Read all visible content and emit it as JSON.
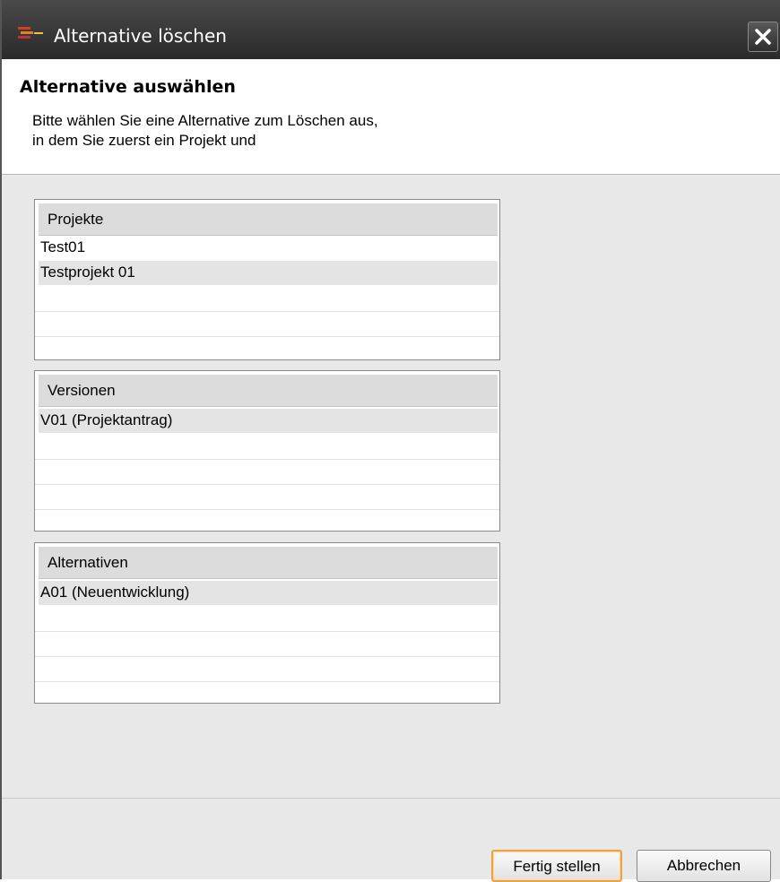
{
  "window": {
    "title": "Alternative löschen",
    "icon": "app-bars-icon",
    "close_icon": "close-icon"
  },
  "header": {
    "title": "Alternative auswählen",
    "description_lines": [
      "Bitte wählen Sie eine Alternative zum Löschen aus,",
      "in dem Sie zuerst ein Projekt und"
    ]
  },
  "tables": {
    "projects": {
      "header": "Projekte",
      "rows": [
        "Test01",
        "Testprojekt 01"
      ],
      "selected_index": 1
    },
    "versions": {
      "header": "Versionen",
      "rows": [
        "V01 (Projektantrag)"
      ],
      "selected_index": 0
    },
    "alternatives": {
      "header": "Alternativen",
      "rows": [
        "A01 (Neuentwicklung)"
      ],
      "selected_index": 0
    }
  },
  "buttons": {
    "finish": "Fertig stellen",
    "cancel": "Abbrechen"
  },
  "colors": {
    "titlebar": "#3a3a3a",
    "default_button_border": "#f0a040",
    "selected_row": "#e4e4e4"
  }
}
